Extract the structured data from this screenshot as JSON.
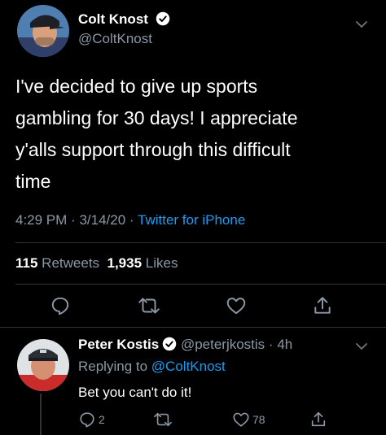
{
  "tweet": {
    "author": {
      "name": "Colt Knost",
      "handle": "@ColtKnost"
    },
    "lines": [
      "I've decided to give up sports",
      "gambling for 30 days! I appreciate",
      "y'alls support through this difficult",
      "time"
    ],
    "time": "4:29 PM",
    "date": "3/14/20",
    "separator": "·",
    "source": "Twitter for iPhone",
    "retweets_count": "115",
    "retweets_label": "Retweets",
    "likes_count": "1,935",
    "likes_label": "Likes"
  },
  "reply": {
    "author": {
      "name": "Peter Kostis",
      "handle": "@peterjkostis",
      "age": "4h"
    },
    "replying_prefix": "Replying to",
    "replying_to": "@ColtKnost",
    "text": "Bet you can't do it!",
    "replies_count": "2",
    "likes_count": "78"
  },
  "colors": {
    "accent": "#1d9bf0",
    "muted": "#8b98a5",
    "divider": "#2f3336"
  },
  "icons": [
    "verified-badge-icon",
    "chevron-down-icon",
    "reply-icon",
    "retweet-icon",
    "like-icon",
    "share-icon"
  ]
}
